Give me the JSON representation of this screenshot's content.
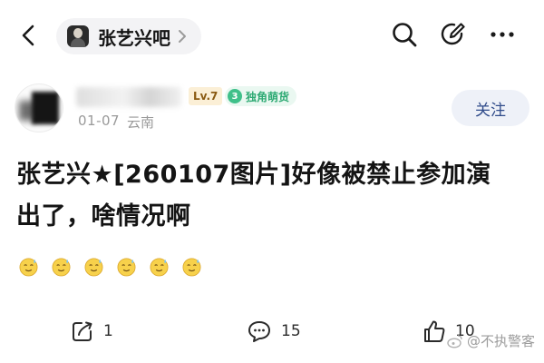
{
  "topbar": {
    "forum_name": "张艺兴吧",
    "icons": [
      "back-arrow-icon",
      "forum-avatar",
      "chevron-right-icon",
      "search-icon",
      "edit-icon",
      "more-icon"
    ]
  },
  "author": {
    "level": "Lv.7",
    "title_level": "3",
    "title_text": "独角萌货",
    "date": "01-07",
    "location": "云南",
    "follow_label": "关注"
  },
  "post": {
    "title_line1": "张艺兴★[260107图片]好像被禁止参加演",
    "title_line2": "出了，啥情况啊",
    "emoji_count": 6
  },
  "actions": {
    "share_count": "1",
    "comment_count": "15",
    "like_count": "10"
  },
  "watermark": {
    "text": "@不执警客"
  },
  "colors": {
    "follow_bg": "#eef1f8",
    "follow_text": "#2f4b8a",
    "level_bg": "#fbefd6",
    "title_badge": "#3fc08a",
    "muted_text": "#9a9a9a"
  }
}
